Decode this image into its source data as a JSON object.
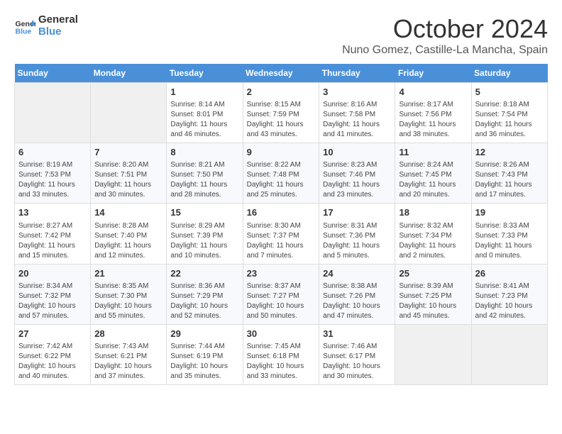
{
  "header": {
    "logo_line1": "General",
    "logo_line2": "Blue",
    "title": "October 2024",
    "subtitle": "Nuno Gomez, Castille-La Mancha, Spain"
  },
  "weekdays": [
    "Sunday",
    "Monday",
    "Tuesday",
    "Wednesday",
    "Thursday",
    "Friday",
    "Saturday"
  ],
  "weeks": [
    [
      {
        "day": "",
        "info": ""
      },
      {
        "day": "",
        "info": ""
      },
      {
        "day": "1",
        "info": "Sunrise: 8:14 AM\nSunset: 8:01 PM\nDaylight: 11 hours and 46 minutes."
      },
      {
        "day": "2",
        "info": "Sunrise: 8:15 AM\nSunset: 7:59 PM\nDaylight: 11 hours and 43 minutes."
      },
      {
        "day": "3",
        "info": "Sunrise: 8:16 AM\nSunset: 7:58 PM\nDaylight: 11 hours and 41 minutes."
      },
      {
        "day": "4",
        "info": "Sunrise: 8:17 AM\nSunset: 7:56 PM\nDaylight: 11 hours and 38 minutes."
      },
      {
        "day": "5",
        "info": "Sunrise: 8:18 AM\nSunset: 7:54 PM\nDaylight: 11 hours and 36 minutes."
      }
    ],
    [
      {
        "day": "6",
        "info": "Sunrise: 8:19 AM\nSunset: 7:53 PM\nDaylight: 11 hours and 33 minutes."
      },
      {
        "day": "7",
        "info": "Sunrise: 8:20 AM\nSunset: 7:51 PM\nDaylight: 11 hours and 30 minutes."
      },
      {
        "day": "8",
        "info": "Sunrise: 8:21 AM\nSunset: 7:50 PM\nDaylight: 11 hours and 28 minutes."
      },
      {
        "day": "9",
        "info": "Sunrise: 8:22 AM\nSunset: 7:48 PM\nDaylight: 11 hours and 25 minutes."
      },
      {
        "day": "10",
        "info": "Sunrise: 8:23 AM\nSunset: 7:46 PM\nDaylight: 11 hours and 23 minutes."
      },
      {
        "day": "11",
        "info": "Sunrise: 8:24 AM\nSunset: 7:45 PM\nDaylight: 11 hours and 20 minutes."
      },
      {
        "day": "12",
        "info": "Sunrise: 8:26 AM\nSunset: 7:43 PM\nDaylight: 11 hours and 17 minutes."
      }
    ],
    [
      {
        "day": "13",
        "info": "Sunrise: 8:27 AM\nSunset: 7:42 PM\nDaylight: 11 hours and 15 minutes."
      },
      {
        "day": "14",
        "info": "Sunrise: 8:28 AM\nSunset: 7:40 PM\nDaylight: 11 hours and 12 minutes."
      },
      {
        "day": "15",
        "info": "Sunrise: 8:29 AM\nSunset: 7:39 PM\nDaylight: 11 hours and 10 minutes."
      },
      {
        "day": "16",
        "info": "Sunrise: 8:30 AM\nSunset: 7:37 PM\nDaylight: 11 hours and 7 minutes."
      },
      {
        "day": "17",
        "info": "Sunrise: 8:31 AM\nSunset: 7:36 PM\nDaylight: 11 hours and 5 minutes."
      },
      {
        "day": "18",
        "info": "Sunrise: 8:32 AM\nSunset: 7:34 PM\nDaylight: 11 hours and 2 minutes."
      },
      {
        "day": "19",
        "info": "Sunrise: 8:33 AM\nSunset: 7:33 PM\nDaylight: 11 hours and 0 minutes."
      }
    ],
    [
      {
        "day": "20",
        "info": "Sunrise: 8:34 AM\nSunset: 7:32 PM\nDaylight: 10 hours and 57 minutes."
      },
      {
        "day": "21",
        "info": "Sunrise: 8:35 AM\nSunset: 7:30 PM\nDaylight: 10 hours and 55 minutes."
      },
      {
        "day": "22",
        "info": "Sunrise: 8:36 AM\nSunset: 7:29 PM\nDaylight: 10 hours and 52 minutes."
      },
      {
        "day": "23",
        "info": "Sunrise: 8:37 AM\nSunset: 7:27 PM\nDaylight: 10 hours and 50 minutes."
      },
      {
        "day": "24",
        "info": "Sunrise: 8:38 AM\nSunset: 7:26 PM\nDaylight: 10 hours and 47 minutes."
      },
      {
        "day": "25",
        "info": "Sunrise: 8:39 AM\nSunset: 7:25 PM\nDaylight: 10 hours and 45 minutes."
      },
      {
        "day": "26",
        "info": "Sunrise: 8:41 AM\nSunset: 7:23 PM\nDaylight: 10 hours and 42 minutes."
      }
    ],
    [
      {
        "day": "27",
        "info": "Sunrise: 7:42 AM\nSunset: 6:22 PM\nDaylight: 10 hours and 40 minutes."
      },
      {
        "day": "28",
        "info": "Sunrise: 7:43 AM\nSunset: 6:21 PM\nDaylight: 10 hours and 37 minutes."
      },
      {
        "day": "29",
        "info": "Sunrise: 7:44 AM\nSunset: 6:19 PM\nDaylight: 10 hours and 35 minutes."
      },
      {
        "day": "30",
        "info": "Sunrise: 7:45 AM\nSunset: 6:18 PM\nDaylight: 10 hours and 33 minutes."
      },
      {
        "day": "31",
        "info": "Sunrise: 7:46 AM\nSunset: 6:17 PM\nDaylight: 10 hours and 30 minutes."
      },
      {
        "day": "",
        "info": ""
      },
      {
        "day": "",
        "info": ""
      }
    ]
  ]
}
